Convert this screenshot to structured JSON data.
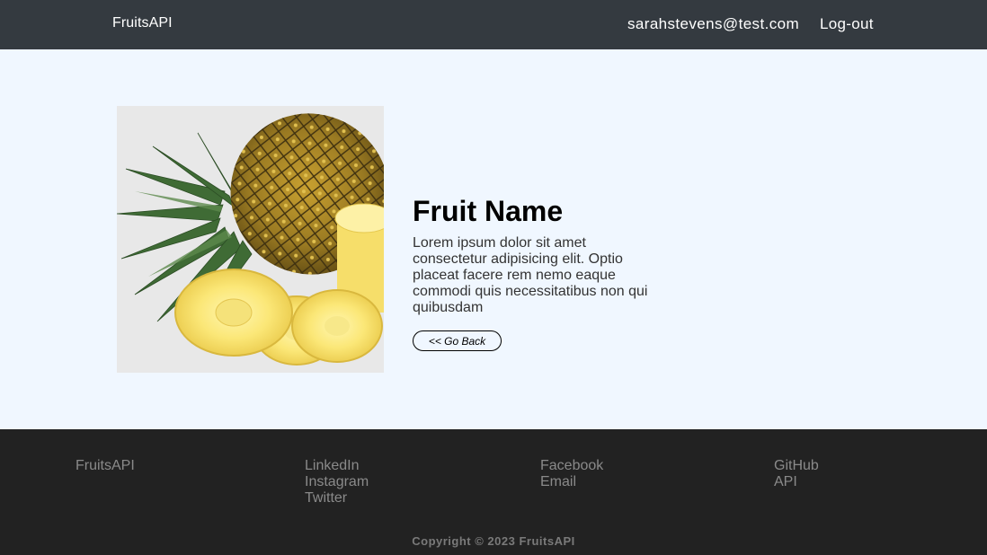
{
  "navbar": {
    "brand": "FruitsAPI",
    "user_email": "sarahstevens@test.com",
    "logout_label": "Log-out"
  },
  "fruit": {
    "image_alt": "pineapple",
    "name": "Fruit Name",
    "description": "Lorem ipsum dolor sit amet consectetur adipisicing elit. Optio placeat facere rem nemo eaque commodi quis necessitatibus non qui quibusdam",
    "back_label": "<< Go Back"
  },
  "footer": {
    "brand": "FruitsAPI",
    "social_links": [
      "LinkedIn",
      "Instagram",
      "Twitter"
    ],
    "contact_links": [
      "Facebook",
      "Email"
    ],
    "dev_links": [
      "GitHub",
      "API"
    ],
    "copyright": "Copyright © 2023 FruitsAPI"
  },
  "colors": {
    "navbar_bg": "#343a40",
    "main_bg": "#f0f7ff",
    "footer_bg": "#222222",
    "footer_text": "#8a8a8a"
  }
}
